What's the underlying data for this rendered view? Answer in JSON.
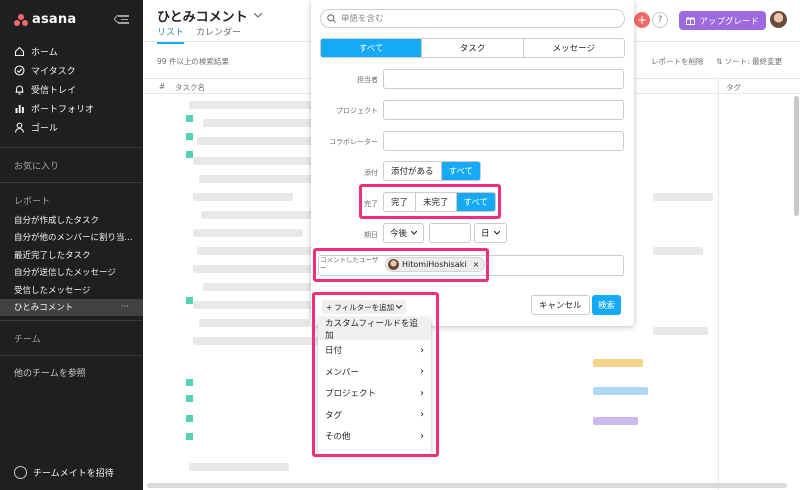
{
  "sidebar": {
    "logo_text": "asana",
    "nav_items": [
      {
        "label": "ホーム",
        "icon": "home-icon"
      },
      {
        "label": "マイタスク",
        "icon": "check-circle-icon"
      },
      {
        "label": "受信トレイ",
        "icon": "bell-icon"
      },
      {
        "label": "ポートフォリオ",
        "icon": "bar-chart-icon"
      },
      {
        "label": "ゴール",
        "icon": "person-icon"
      }
    ],
    "favorites_label": "お気に入り",
    "reports_label": "レポート",
    "reports": [
      "自分が作成したタスク",
      "自分が他のメンバーに割り当...",
      "最近完了したタスク",
      "自分が送信したメッセージ",
      "受信したメッセージ",
      "ひとみコメント"
    ],
    "active_report_more": "···",
    "teams_label": "チーム",
    "browse_teams": "他のチームを参照",
    "invite_label": "チームメイトを招待"
  },
  "main": {
    "title": "ひとみコメント",
    "tabs": [
      "リスト",
      "カレンダー"
    ],
    "result_count": "99 件以上の検索結果",
    "remove_report": "レポートを削除",
    "sort_label": "ソート: 最終変更",
    "columns": {
      "num": "#",
      "task": "タスク名",
      "tag": "タグ"
    },
    "upgrade_label": "アップグレード",
    "help_label": "?",
    "plus_label": "+"
  },
  "filter": {
    "search_placeholder": "単語を含む",
    "type_tabs": [
      "すべて",
      "タスク",
      "メッセージ"
    ],
    "type_selected": 0,
    "assignee_label": "担当者",
    "project_label": "プロジェクト",
    "collaborator_label": "コラボレーター",
    "attachment_label": "添付",
    "attachment_options": [
      "添付がある",
      "すべて"
    ],
    "attachment_selected": 1,
    "completion_label": "完了",
    "completion_options": [
      "完了",
      "未完了",
      "すべて"
    ],
    "completion_selected": 2,
    "due_label": "期日",
    "due_relation": "今後",
    "due_value": "",
    "due_unit": "日",
    "commenter_label": "コメントしたユーザー",
    "commenter_chip": "HitomiHoshisaki",
    "chip_close": "×",
    "add_filter_label": "フィルターを追加",
    "cancel_label": "キャンセル",
    "search_label": "検索"
  },
  "filter_menu": {
    "items": [
      {
        "label": "カスタムフィールドを追加",
        "submenu": false
      },
      {
        "label": "日付",
        "submenu": true
      },
      {
        "label": "メンバー",
        "submenu": true
      },
      {
        "label": "プロジェクト",
        "submenu": true
      },
      {
        "label": "タグ",
        "submenu": true
      },
      {
        "label": "その他",
        "submenu": true
      }
    ]
  },
  "colors": {
    "accent": "#14aaf5",
    "highlight": "#ef2f7c",
    "sidebar_bg": "#1e1f21",
    "upgrade_bg": "#9c6ade"
  }
}
